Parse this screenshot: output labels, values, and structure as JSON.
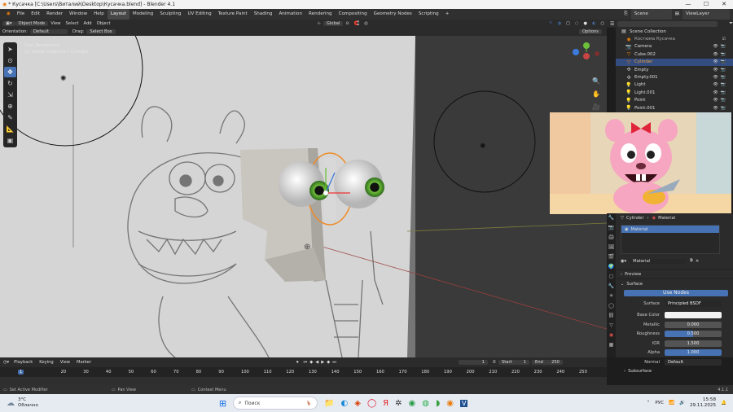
{
  "window": {
    "title": "* Кусачка [C:\\Users\\Виталий\\Desktop\\Кусачка.blend] - Blender 4.1"
  },
  "menu": {
    "items": [
      "File",
      "Edit",
      "Render",
      "Window",
      "Help"
    ]
  },
  "workspaces": [
    "Layout",
    "Modeling",
    "Sculpting",
    "UV Editing",
    "Texture Paint",
    "Shading",
    "Animation",
    "Rendering",
    "Compositing",
    "Geometry Nodes",
    "Scripting"
  ],
  "scene": {
    "label": "Scene",
    "viewlayer": "ViewLayer"
  },
  "viewport_header": {
    "mode": "Object Mode",
    "menus": [
      "View",
      "Select",
      "Add",
      "Object"
    ],
    "transform": "Global",
    "orientation_label": "Orientation:",
    "orientation_value": "Default",
    "drag_label": "Drag:",
    "drag_value": "Select Box",
    "options": "Options"
  },
  "viewport_overlay": {
    "line1": "User Perspective",
    "line2": "(1) Scene Collection | Cylinder"
  },
  "outliner": {
    "search_placeholder": "",
    "root": "Scene Collection",
    "items": [
      {
        "name": "Костюма Кусачка",
        "icon": "◉"
      },
      {
        "name": "Camera",
        "icon": "📷"
      },
      {
        "name": "Cube.002",
        "icon": "▽"
      },
      {
        "name": "Cylinder",
        "icon": "▽",
        "selected": true
      },
      {
        "name": "Empty",
        "icon": "✣"
      },
      {
        "name": "Empty.001",
        "icon": "✣"
      },
      {
        "name": "Light",
        "icon": "💡"
      },
      {
        "name": "Light.001",
        "icon": "💡"
      },
      {
        "name": "Point",
        "icon": "💡"
      },
      {
        "name": "Point.001",
        "icon": "💡"
      }
    ]
  },
  "properties": {
    "breadcrumb_object": "Cylinder",
    "breadcrumb_material": "Material",
    "slot": "Material",
    "material_name": "Material",
    "preview": "Preview",
    "surface": "Surface",
    "use_nodes": "Use Nodes",
    "rows": [
      {
        "label": "Surface",
        "value": "Principled BSDF",
        "style": "dark"
      },
      {
        "label": "Base Color",
        "value": "",
        "style": "white"
      },
      {
        "label": "Metallic",
        "value": "0.000",
        "style": "normal"
      },
      {
        "label": "Roughness",
        "value": "0.500",
        "style": "blue"
      },
      {
        "label": "IOR",
        "value": "1.500",
        "style": "normal"
      },
      {
        "label": "Alpha",
        "value": "1.000",
        "style": "blue"
      },
      {
        "label": "Normal",
        "value": "Default",
        "style": "dark"
      }
    ],
    "subsurface": "Subsurface"
  },
  "timeline": {
    "menus": [
      "Playback",
      "Keying",
      "View",
      "Marker"
    ],
    "current_frame": "1",
    "start_label": "Start",
    "start": "1",
    "end_label": "End",
    "end": "250",
    "ticks": [
      "1",
      "20",
      "30",
      "40",
      "50",
      "60",
      "70",
      "80",
      "90",
      "100",
      "110",
      "120",
      "130",
      "140",
      "150",
      "160",
      "170",
      "180",
      "190",
      "200",
      "210",
      "220",
      "230",
      "240",
      "250"
    ]
  },
  "statusbar": {
    "left": "Set Active Modifier",
    "mid": "Pan View",
    "right": "Context Menu",
    "version": "4.1.1"
  },
  "taskbar": {
    "weather_temp": "3°C",
    "weather_desc": "Облачно",
    "search": "Поиск",
    "lang": "РУС",
    "time": "15:58",
    "date": "29.11.2025"
  },
  "colors": {
    "accent": "#4772b3",
    "selection_orange": "#f08a24",
    "header": "#2b2b2b"
  }
}
